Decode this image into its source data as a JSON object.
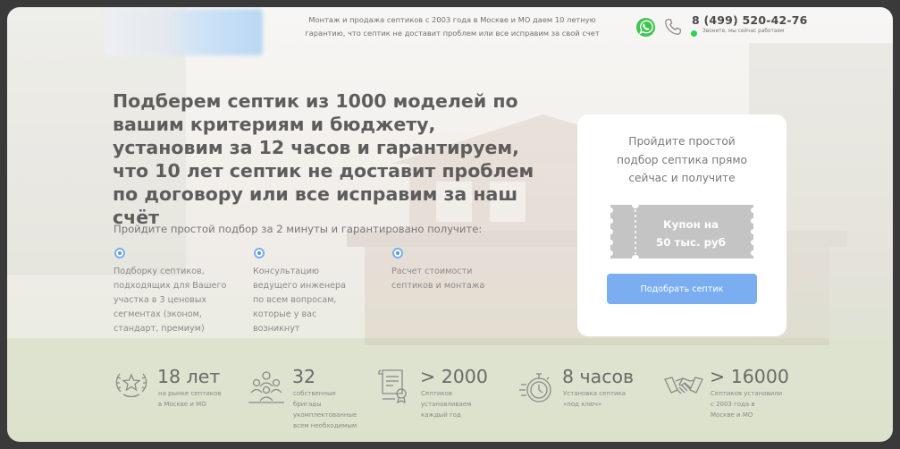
{
  "header": {
    "description_line1": "Монтаж и продажа септиков с 2003 года в Москве и МО даем 10 летную",
    "description_line2": "гарантию, что септик не доставит проблем или все исправим за свой счет",
    "phone": "8 (499) 520-42-76",
    "online_status": "Звоните, мы сейчас работаем",
    "whatsapp_icon": "whatsapp-icon",
    "phone_icon": "phone-icon"
  },
  "hero": {
    "headline": "Подберем септик из 1000 моделей по вашим критериям и бюджету, установим за 12 часов и гарантируем, что 10 лет септик не доставит проблем по договору или все исправим за наш счёт",
    "subtitle": "Пройдите простой подбор за 2 минуты и гарантировано получите:",
    "features": [
      {
        "line1": "Подборку септиков,",
        "line2": "подходящих для Вашего",
        "line3": "участка в 3 ценовых",
        "line4": "сегментах (эконом,",
        "line5": "стандарт, премиум)"
      },
      {
        "line1": "Консультацию",
        "line2": "ведущего инженера",
        "line3": "по всем вопросам,",
        "line4": "которые у вас",
        "line5": "возникнут"
      },
      {
        "line1": "Расчет стоимости",
        "line2": "септиков и монтажа",
        "line3": "",
        "line4": "",
        "line5": ""
      }
    ]
  },
  "quiz_card": {
    "line1": "Пройдите простой",
    "line2": "подбор септика прямо",
    "line3": "сейчас и получите",
    "coupon_line1": "Купон на",
    "coupon_line2": "50 тыс. руб",
    "button_label": "Подобрать септик",
    "accent_color": "#7aaef1"
  },
  "stats": [
    {
      "value": "18 лет",
      "l1": "на рынке септиков",
      "l2": "в Москве и МО",
      "l3": "",
      "l4": "",
      "icon": "laurel-star-icon"
    },
    {
      "value": "32",
      "l1": "собственные",
      "l2": "бригады",
      "l3": "укомплектованные",
      "l4": "всем необходимым",
      "icon": "team-icon"
    },
    {
      "value": "> 2000",
      "l1": "Септиков",
      "l2": "устанавливаем",
      "l3": "каждый год",
      "l4": "",
      "icon": "certificate-icon"
    },
    {
      "value": "8 часов",
      "l1": "Установка септика",
      "l2": "«под ключ»",
      "l3": "",
      "l4": "",
      "icon": "stopwatch-icon"
    },
    {
      "value": "> 16000",
      "l1": "Септиков установили",
      "l2": "с 2003 года в",
      "l3": "Москве и МО",
      "l4": "",
      "icon": "handshake-icon"
    }
  ]
}
